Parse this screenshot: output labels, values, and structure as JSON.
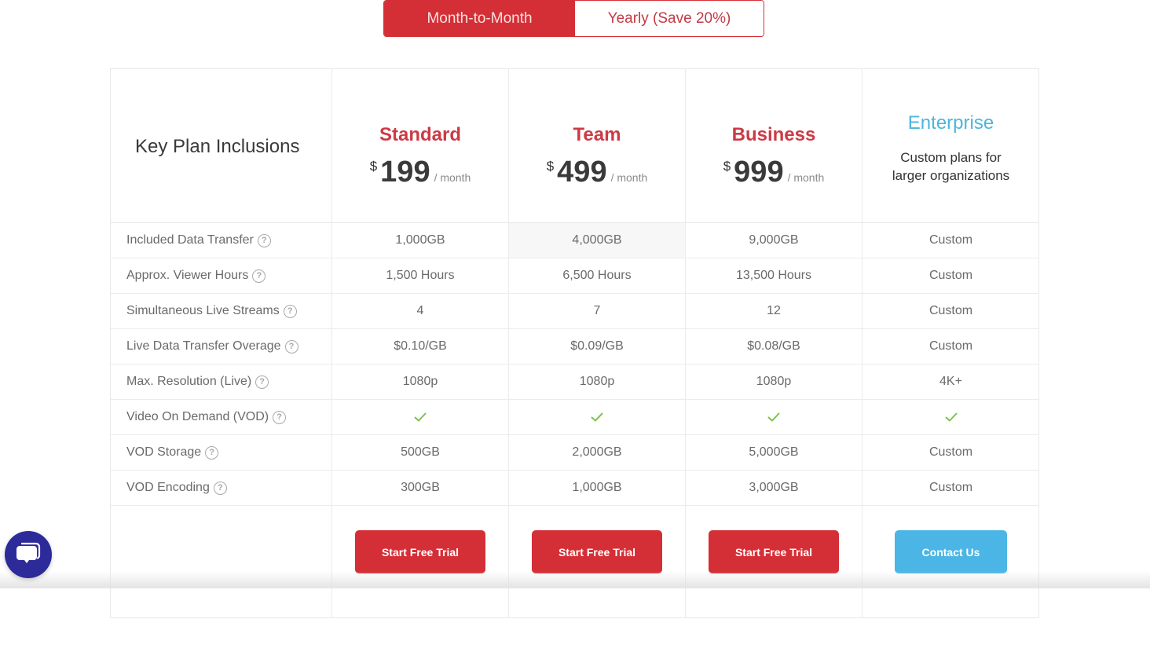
{
  "billing_toggle": {
    "options": [
      {
        "label": "Month-to-Month",
        "active": true
      },
      {
        "label": "Yearly (Save 20%)",
        "active": false
      }
    ]
  },
  "table": {
    "title": "Key Plan Inclusions",
    "plans": [
      {
        "name": "Standard",
        "currency": "$",
        "price": "199",
        "period": "/ month",
        "cta": "Start Free Trial"
      },
      {
        "name": "Team",
        "currency": "$",
        "price": "499",
        "period": "/ month",
        "cta": "Start Free Trial"
      },
      {
        "name": "Business",
        "currency": "$",
        "price": "999",
        "period": "/ month",
        "cta": "Start Free Trial"
      },
      {
        "name": "Enterprise",
        "description_line1": "Custom plans for",
        "description_line2": "larger organizations",
        "cta": "Contact Us"
      }
    ],
    "rows": [
      {
        "label": "Included Data Transfer",
        "values": [
          "1,000GB",
          "4,000GB",
          "9,000GB",
          "Custom"
        ]
      },
      {
        "label": "Approx. Viewer Hours",
        "values": [
          "1,500 Hours",
          "6,500 Hours",
          "13,500 Hours",
          "Custom"
        ]
      },
      {
        "label": "Simultaneous Live Streams",
        "values": [
          "4",
          "7",
          "12",
          "Custom"
        ]
      },
      {
        "label": "Live Data Transfer Overage",
        "values": [
          "$0.10/GB",
          "$0.09/GB",
          "$0.08/GB",
          "Custom"
        ]
      },
      {
        "label": "Max. Resolution (Live)",
        "values": [
          "1080p",
          "1080p",
          "1080p",
          "4K+"
        ]
      },
      {
        "label": "Video On Demand (VOD)",
        "values": [
          "check",
          "check",
          "check",
          "check"
        ]
      },
      {
        "label": "VOD Storage",
        "values": [
          "500GB",
          "2,000GB",
          "5,000GB",
          "Custom"
        ]
      },
      {
        "label": "VOD Encoding",
        "values": [
          "300GB",
          "1,000GB",
          "3,000GB",
          "Custom"
        ]
      }
    ],
    "help_glyph": "?"
  },
  "colors": {
    "brand_red": "#d42f36",
    "plan_red": "#cc3a45",
    "enterprise_blue": "#4db5dc",
    "contact_blue": "#4bb6e5",
    "check_green": "#7cc24a",
    "chat_indigo": "#2d2a9a"
  },
  "chat_widget": {
    "icon": "chat-icon"
  }
}
